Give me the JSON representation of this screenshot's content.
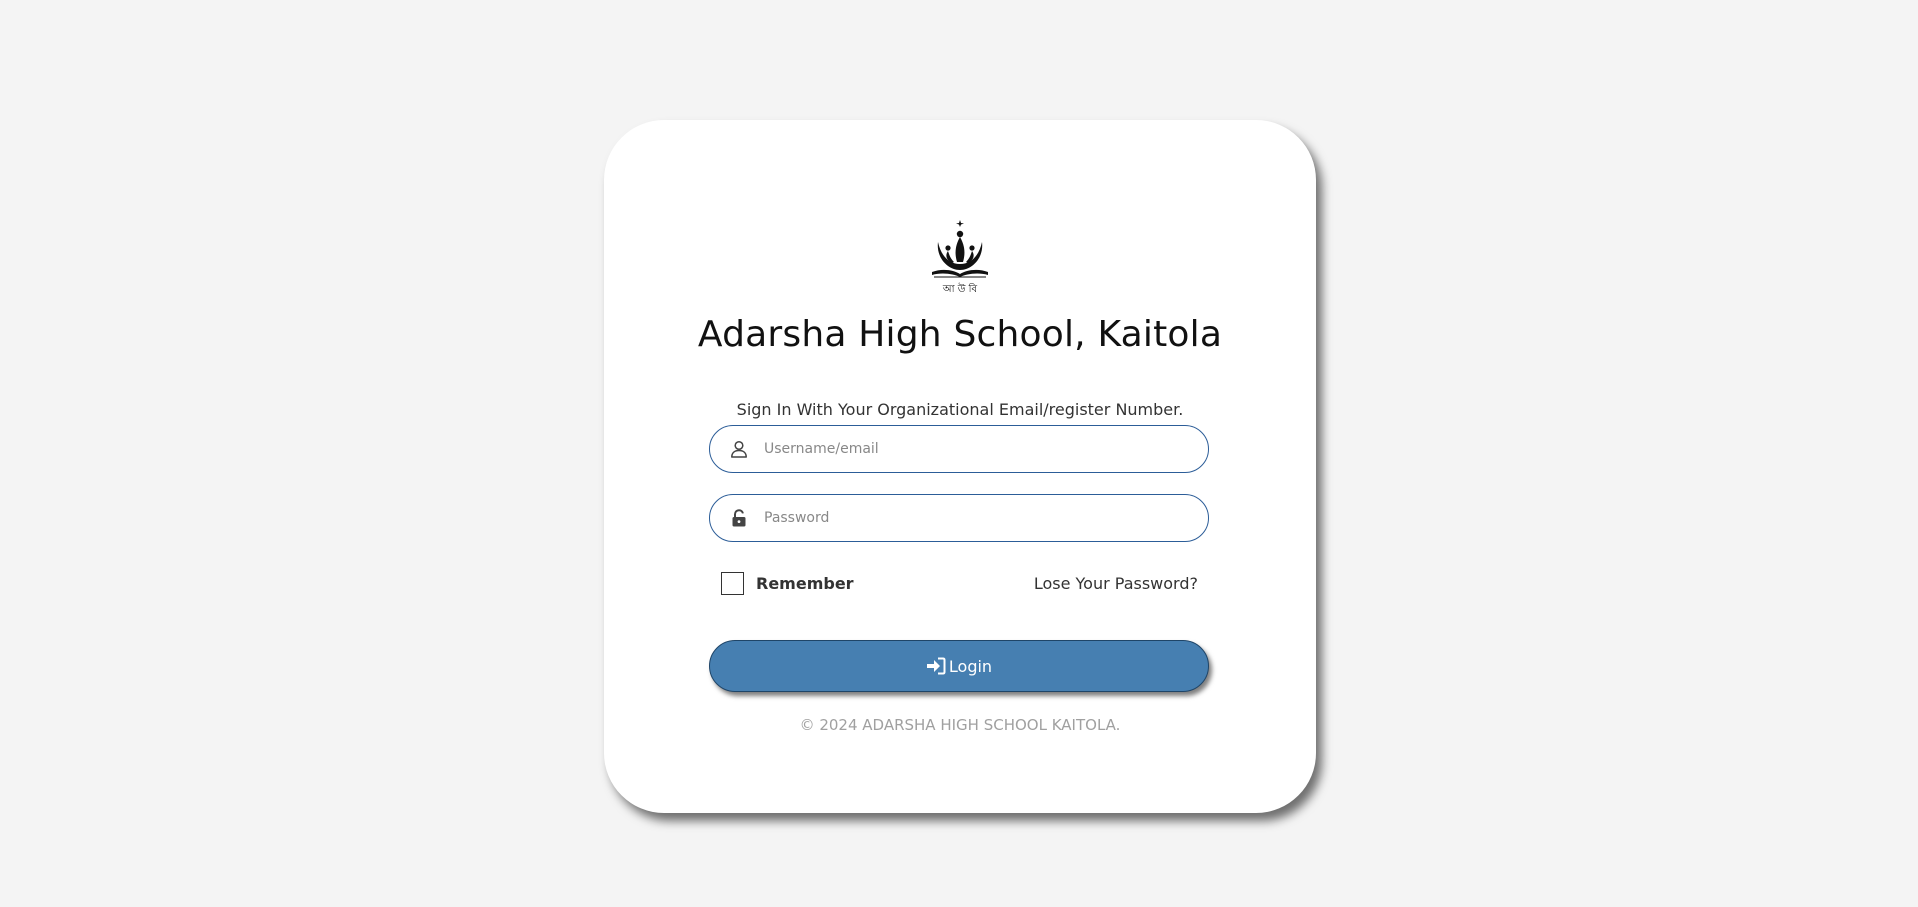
{
  "logo": {
    "caption": "আ উ বি",
    "icon": "school-emblem-icon"
  },
  "school": {
    "name": "Adarsha High School, Kaitola"
  },
  "form": {
    "instruction": "Sign In With Your Organizational Email/register Number.",
    "username": {
      "placeholder": "Username/email",
      "value": "",
      "icon": "user-icon"
    },
    "password": {
      "placeholder": "Password",
      "value": "",
      "icon": "unlock-icon"
    },
    "remember_label": "Remember",
    "remember_checked": false,
    "forgot_label": "Lose Your Password?",
    "login_label": "Login",
    "login_icon": "sign-in-icon"
  },
  "footer": {
    "text": "© 2024 ADARSHA HIGH SCHOOL KAITOLA."
  },
  "colors": {
    "background": "#f4f4f4",
    "card": "#ffffff",
    "field_border": "#2c5d98",
    "button": "#467fb1",
    "footer_text": "#a0a0a0"
  }
}
